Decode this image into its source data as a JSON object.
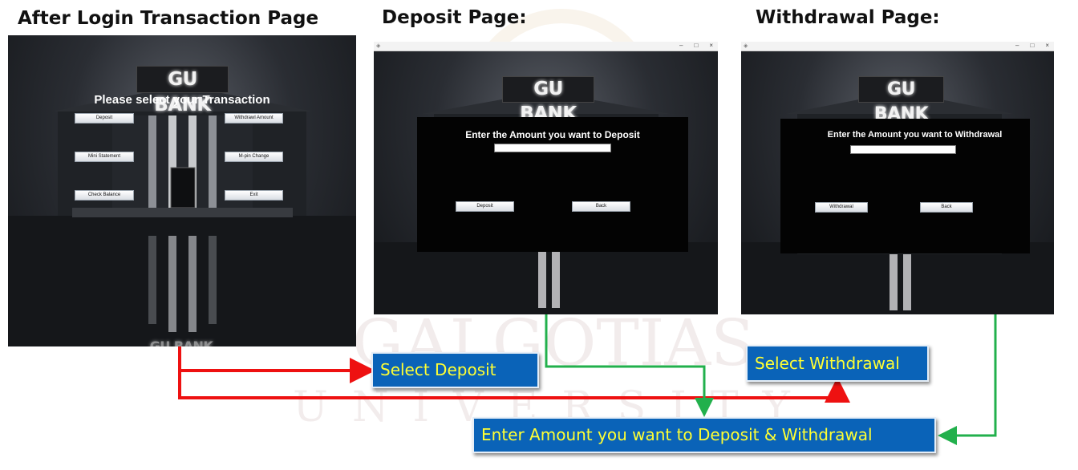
{
  "watermark": {
    "line1": "GALGOTIAS",
    "line2": "UNIVERSITY"
  },
  "headings": {
    "left": "After Login Transaction Page",
    "middle": "Deposit Page:",
    "right": "Withdrawal Page:"
  },
  "transaction_screen": {
    "logo": "GU BANK",
    "prompt": "Please select your Transaction",
    "buttons": {
      "deposit": "Deposit",
      "withdrawl": "Withdrawl Amount",
      "mini_statement": "Mini Statement",
      "mpin": "M-pin Change",
      "check_balance": "Check Balance",
      "exit": "Exit"
    },
    "reflection_logo": "GU BANK"
  },
  "deposit_screen": {
    "logo": "GU BANK",
    "prompt": "Enter the Amount you want to Deposit",
    "input_value": "",
    "buttons": {
      "deposit": "Deposit",
      "back": "Back"
    }
  },
  "withdrawal_screen": {
    "logo": "GU BANK",
    "prompt": "Enter the Amount you want to Withdrawal",
    "input_value": "",
    "buttons": {
      "withdrawal": "Withdrawal",
      "back": "Back"
    }
  },
  "window_controls": {
    "minimize": "–",
    "maximize": "□",
    "close": "×"
  },
  "callouts": {
    "select_deposit": "Select Deposit",
    "select_withdrawal": "Select Withdrawal",
    "enter_amount": "Enter Amount you want to Deposit & Withdrawal"
  },
  "colors": {
    "callout_bg": "#0a63b8",
    "callout_text": "#ffff33",
    "red_arrow": "#ee1111",
    "green_arrow": "#22b04c"
  }
}
